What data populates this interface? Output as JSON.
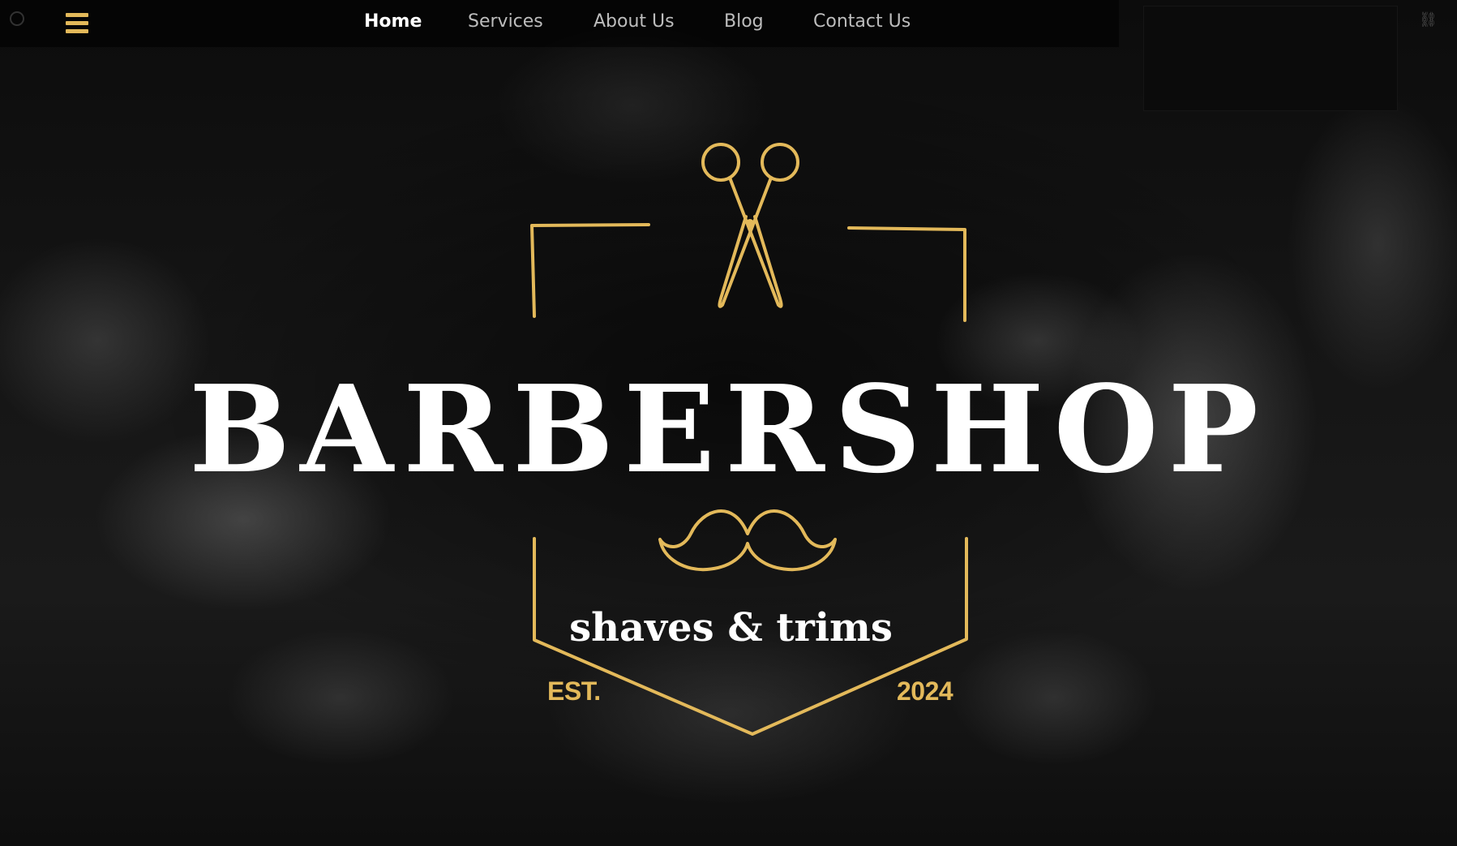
{
  "nav": {
    "items": [
      {
        "label": "Home",
        "active": true
      },
      {
        "label": "Services",
        "active": false
      },
      {
        "label": "About Us",
        "active": false
      },
      {
        "label": "Blog",
        "active": false
      },
      {
        "label": "Contact Us",
        "active": false
      }
    ],
    "menu_icon": "hamburger-menu-icon"
  },
  "hero": {
    "title": "BARBERSHOP",
    "subtitle": "shaves & trims",
    "est_label": "EST.",
    "est_year": "2024",
    "icons": [
      "scissors-icon",
      "mustache-icon"
    ]
  },
  "colors": {
    "gold": "#e3b95a",
    "text": "#ffffff",
    "nav_inactive": "#bdbdbd",
    "background": "#050505"
  }
}
